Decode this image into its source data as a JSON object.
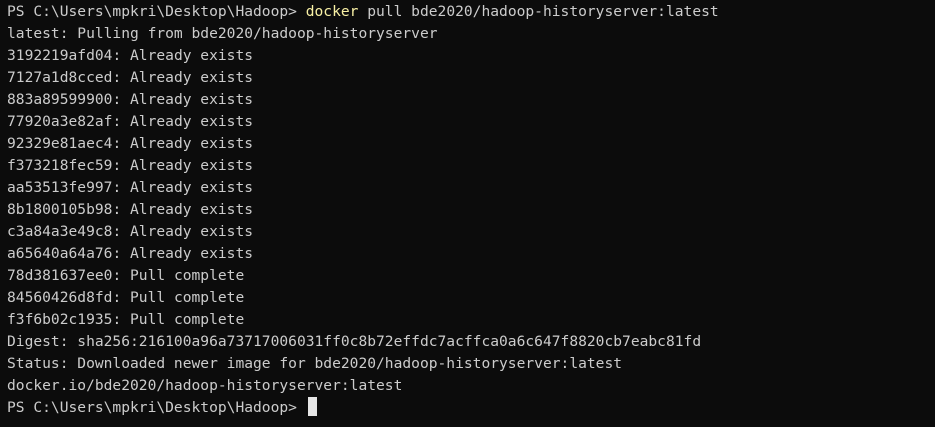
{
  "terminal": {
    "prompt": "PS C:\\Users\\mpkri\\Desktop\\Hadoop> ",
    "command": {
      "name": "docker",
      "args": " pull bde2020/hadoop-historyserver:latest"
    },
    "pulling": "latest: Pulling from bde2020/hadoop-historyserver",
    "layers": [
      {
        "id": "3192219afd04",
        "status": "Already exists"
      },
      {
        "id": "7127a1d8cced",
        "status": "Already exists"
      },
      {
        "id": "883a89599900",
        "status": "Already exists"
      },
      {
        "id": "77920a3e82af",
        "status": "Already exists"
      },
      {
        "id": "92329e81aec4",
        "status": "Already exists"
      },
      {
        "id": "f373218fec59",
        "status": "Already exists"
      },
      {
        "id": "aa53513fe997",
        "status": "Already exists"
      },
      {
        "id": "8b1800105b98",
        "status": "Already exists"
      },
      {
        "id": "c3a84a3e49c8",
        "status": "Already exists"
      },
      {
        "id": "a65640a64a76",
        "status": "Already exists"
      },
      {
        "id": "78d381637ee0",
        "status": "Pull complete"
      },
      {
        "id": "84560426d8fd",
        "status": "Pull complete"
      },
      {
        "id": "f3f6b02c1935",
        "status": "Pull complete"
      }
    ],
    "digest": "Digest: sha256:216100a96a73717006031ff0c8b72effdc7acffca0a6c647f8820cb7eabc81fd",
    "status": "Status: Downloaded newer image for bde2020/hadoop-historyserver:latest",
    "image": "docker.io/bde2020/hadoop-historyserver:latest",
    "final_prompt": "PS C:\\Users\\mpkri\\Desktop\\Hadoop> "
  },
  "colors": {
    "background": "#0c0c0c",
    "text": "#cccccc",
    "command_highlight": "#f9f1a5",
    "cursor": "#e6e6e6"
  }
}
